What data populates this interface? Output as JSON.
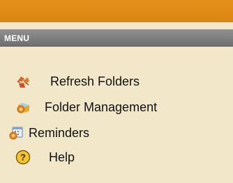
{
  "menu": {
    "title": "MENU",
    "items": [
      {
        "label": "Refresh Folders",
        "icon": "refresh-folders-icon"
      },
      {
        "label": "Folder Management",
        "icon": "folder-gear-icon"
      },
      {
        "label": "Reminders",
        "icon": "calendar-gear-icon"
      },
      {
        "label": "Help",
        "icon": "help-question-icon"
      }
    ]
  },
  "colors": {
    "top_bar": "#e6911c",
    "header": "#7f7f7f",
    "panel_bg": "#f3e7c9",
    "text": "#111111"
  }
}
